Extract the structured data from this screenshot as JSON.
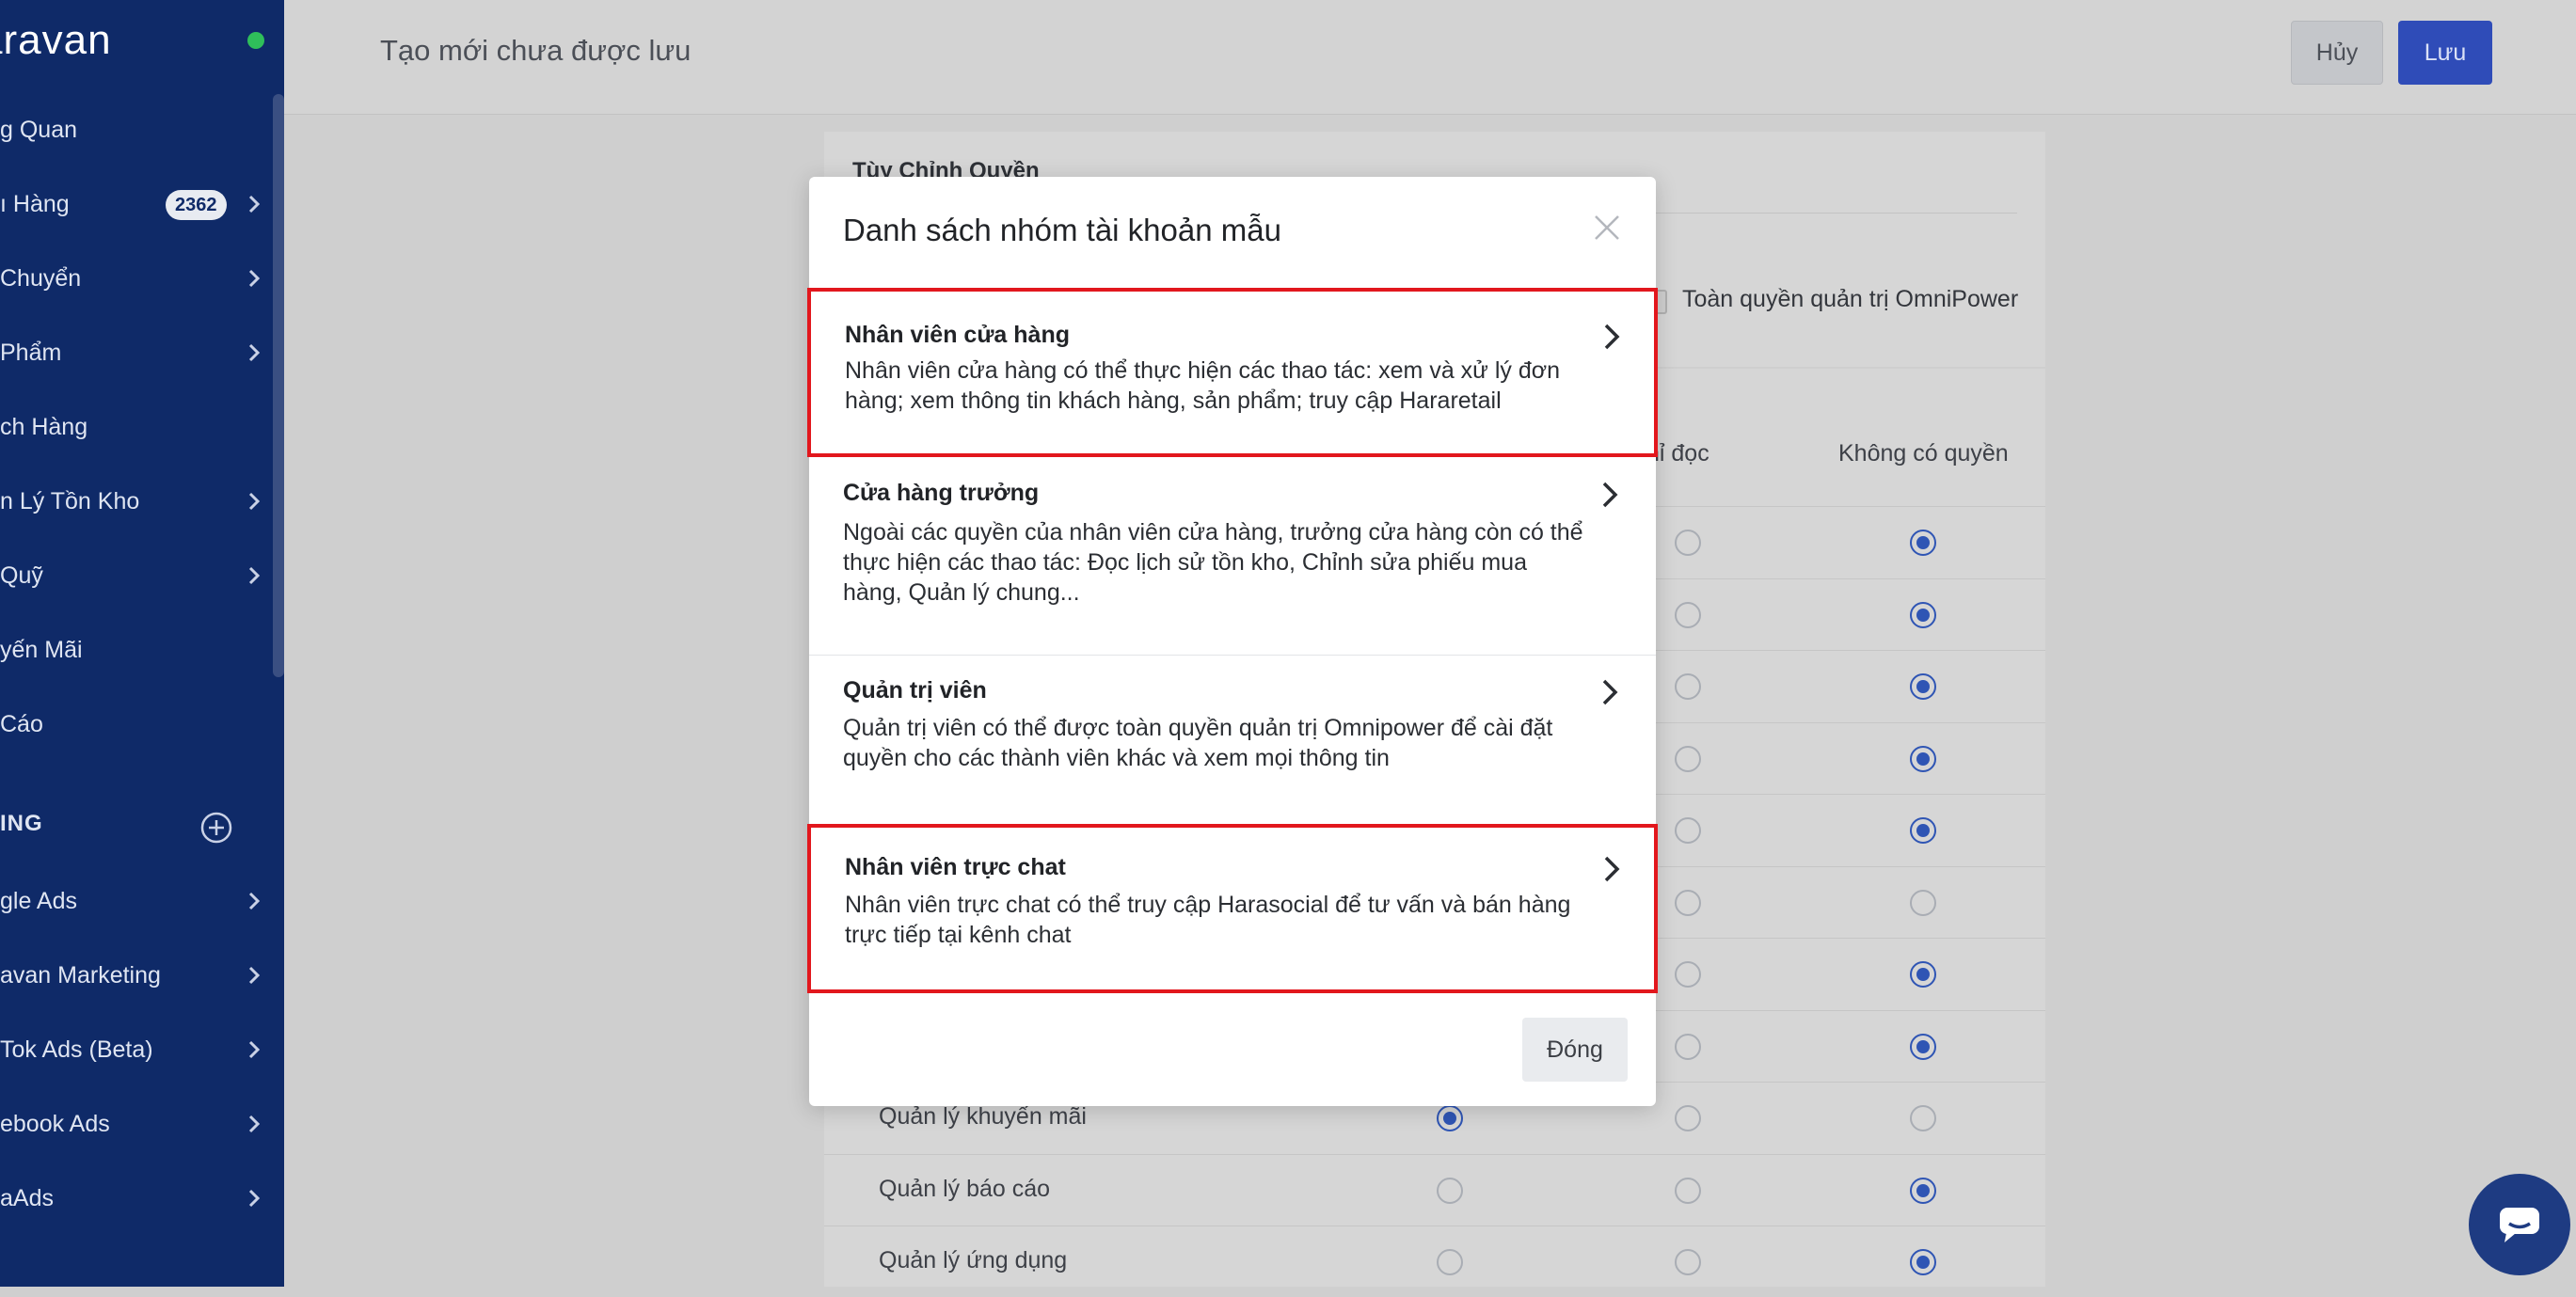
{
  "sidebar": {
    "brand": "aravan",
    "items": [
      {
        "label": "g Quan"
      },
      {
        "label": "ı Hàng",
        "badge": "2362"
      },
      {
        "label": " Chuyển"
      },
      {
        "label": " Phẩm"
      },
      {
        "label": "ch Hàng"
      },
      {
        "label": "n Lý Tồn Kho"
      },
      {
        "label": "Quỹ"
      },
      {
        "label": "yến Mãi"
      },
      {
        "label": " Cáo"
      }
    ],
    "section_title": "ING",
    "marketing_items": [
      {
        "label": "gle Ads"
      },
      {
        "label": "avan Marketing"
      },
      {
        "label": "Tok Ads (Beta)"
      },
      {
        "label": "ebook Ads"
      },
      {
        "label": "aAds"
      }
    ]
  },
  "header": {
    "title": "Tạo mới chưa được lưu",
    "cancel_label": "Hủy",
    "save_label": "Lưu"
  },
  "background": {
    "card_title": "Tùy Chỉnh Quyền",
    "full_admin_label": "Toàn quyền quản trị OmniPower",
    "columns": [
      "hỉ đọc",
      "Không có quyền"
    ],
    "rows": [
      {
        "label": "",
        "selected": 2
      },
      {
        "label": "",
        "selected": 2
      },
      {
        "label": "",
        "selected": 2
      },
      {
        "label": "",
        "selected": 2
      },
      {
        "label": "",
        "selected": 2
      },
      {
        "label": "",
        "selected": -1
      },
      {
        "label": "",
        "selected": 2
      },
      {
        "label": "",
        "selected": 2
      },
      {
        "label": "Quản lý khuyến mãi",
        "selected": 0
      },
      {
        "label": "Quản lý báo cáo",
        "selected": 2
      },
      {
        "label": "Quản lý ứng dụng",
        "selected": 2
      }
    ]
  },
  "modal": {
    "title": "Danh sách nhóm tài khoản mẫu",
    "close_button_label": "Đóng",
    "templates": [
      {
        "name": "Nhân viên cửa hàng",
        "description": "Nhân viên cửa hàng có thể thực hiện các thao tác: xem và xử lý đơn hàng; xem thông tin khách hàng, sản phẩm; truy cập Hararetail",
        "highlighted": true
      },
      {
        "name": "Cửa hàng trưởng",
        "description": "Ngoài các quyền của nhân viên cửa hàng, trưởng cửa hàng còn có thể thực hiện các thao tác: Đọc lịch sử tồn kho, Chỉnh sửa phiếu mua hàng, Quản lý chung...",
        "highlighted": false
      },
      {
        "name": "Quản trị viên",
        "description": "Quản trị viên có thể được toàn quyền quản trị Omnipower để cài đặt quyền cho các thành viên khác và xem mọi thông tin",
        "highlighted": false
      },
      {
        "name": "Nhân viên trực chat",
        "description": "Nhân viên trực chat có thể truy cập Harasocial để tư vấn và bán hàng trực tiếp tại kênh chat",
        "highlighted": true
      }
    ]
  },
  "colors": {
    "sidebar_bg": "#0f2a68",
    "primary": "#2f4cb8",
    "highlight_border": "#e2171d"
  }
}
